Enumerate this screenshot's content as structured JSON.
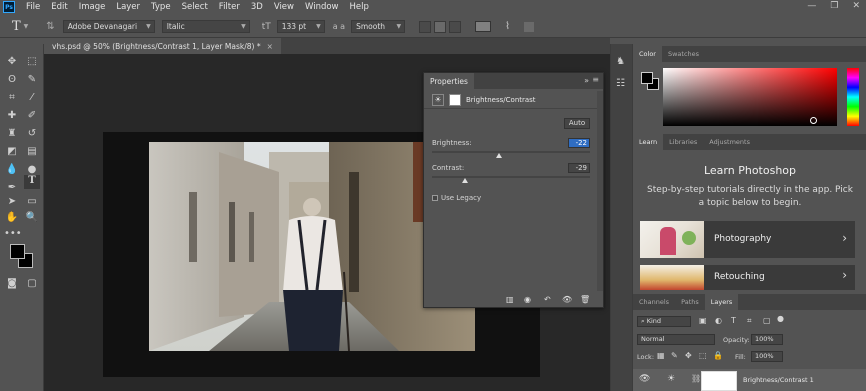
{
  "app": {
    "logo": "Ps",
    "menu": [
      "File",
      "Edit",
      "Image",
      "Layer",
      "Type",
      "Select",
      "Filter",
      "3D",
      "View",
      "Window",
      "Help"
    ],
    "window_controls": [
      "—",
      "❐",
      "✕"
    ]
  },
  "options_bar": {
    "tool_glyph": "T",
    "font_family": "Adobe Devanagari",
    "font_style": "Italic",
    "font_size": "133 pt",
    "antialias": "Smooth",
    "text_color": "#808080"
  },
  "document": {
    "tab_title": "vhs.psd @ 50% (Brightness/Contrast 1, Layer Mask/8) *",
    "tab_close": "×"
  },
  "properties": {
    "tab_title": "Properties",
    "panel_icons": "»",
    "menu_icon": "≡",
    "adjustment_name": "Brightness/Contrast",
    "auto_label": "Auto",
    "brightness_label": "Brightness:",
    "brightness_value": "-22",
    "brightness_fraction": 0.46,
    "contrast_label": "Contrast:",
    "contrast_value": "-29",
    "contrast_fraction": 0.23,
    "legacy_label": "Use Legacy"
  },
  "color_panel": {
    "tabs": [
      "Color",
      "Swatches"
    ],
    "foreground": "#000000",
    "background": "#000000",
    "hue": "#ff0000"
  },
  "learn_panel": {
    "tabs": [
      "Learn",
      "Libraries",
      "Adjustments"
    ],
    "title": "Learn Photoshop",
    "subtitle": "Step-by-step tutorials directly in the app. Pick a topic below to begin.",
    "cards": [
      {
        "label": "Photography",
        "chevron": "›"
      },
      {
        "label": "Retouching",
        "chevron": "›"
      }
    ]
  },
  "layers_panel": {
    "tabs": [
      "Channels",
      "Paths",
      "Layers"
    ],
    "filter": "Kind",
    "blend_mode": "Normal",
    "opacity_label": "Opacity:",
    "opacity": "100%",
    "lock_label": "Lock:",
    "fill_label": "Fill:",
    "fill": "100%",
    "layer_name": "Brightness/Contrast 1"
  }
}
